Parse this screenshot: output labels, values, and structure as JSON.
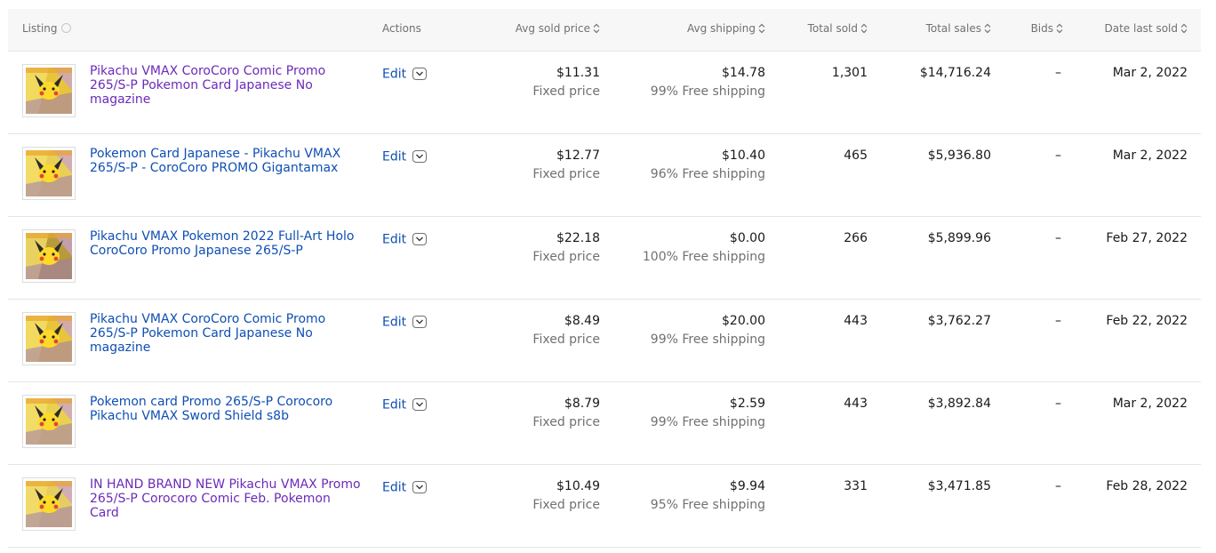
{
  "columns": {
    "listing": "Listing",
    "actions": "Actions",
    "avg_sold_price": "Avg sold price",
    "avg_shipping": "Avg shipping",
    "total_sold": "Total sold",
    "total_sales": "Total sales",
    "bids": "Bids",
    "date_last_sold": "Date last sold"
  },
  "icons": {
    "sort": "sort-icon",
    "info": "info-icon",
    "dropdown": "chevron-down-icon"
  },
  "colors": {
    "visited_link": "#6b2bb8",
    "link": "#0f4fb3",
    "muted": "#707070"
  },
  "rows": [
    {
      "title": "Pikachu VMAX CoroCoro Comic Promo 265/S-P Pokemon Card Japanese No magazine",
      "visited": true,
      "edit": "Edit",
      "price": "$11.31",
      "price_format": "Fixed price",
      "shipping": "$14.78",
      "free_shipping": "99% Free shipping",
      "total_sold": "1,301",
      "total_sales": "$14,716.24",
      "bids": "–",
      "date_last_sold": "Mar 2, 2022"
    },
    {
      "title": "Pokemon Card Japanese - Pikachu VMAX 265/S-P - CoroCoro PROMO Gigantamax",
      "visited": false,
      "edit": "Edit",
      "price": "$12.77",
      "price_format": "Fixed price",
      "shipping": "$10.40",
      "free_shipping": "96% Free shipping",
      "total_sold": "465",
      "total_sales": "$5,936.80",
      "bids": "–",
      "date_last_sold": "Mar 2, 2022"
    },
    {
      "title": "Pikachu VMAX Pokemon 2022 Full-Art Holo CoroCoro Promo Japanese 265/S-P",
      "visited": false,
      "edit": "Edit",
      "price": "$22.18",
      "price_format": "Fixed price",
      "shipping": "$0.00",
      "free_shipping": "100% Free shipping",
      "total_sold": "266",
      "total_sales": "$5,899.96",
      "bids": "–",
      "date_last_sold": "Feb 27, 2022"
    },
    {
      "title": "Pikachu VMAX CoroCoro Comic Promo 265/S-P Pokemon Card Japanese No magazine",
      "visited": false,
      "edit": "Edit",
      "price": "$8.49",
      "price_format": "Fixed price",
      "shipping": "$20.00",
      "free_shipping": "99% Free shipping",
      "total_sold": "443",
      "total_sales": "$3,762.27",
      "bids": "–",
      "date_last_sold": "Feb 22, 2022"
    },
    {
      "title": "Pokemon card Promo 265/S-P Corocoro Pikachu VMAX Sword Shield s8b",
      "visited": false,
      "edit": "Edit",
      "price": "$8.79",
      "price_format": "Fixed price",
      "shipping": "$2.59",
      "free_shipping": "99% Free shipping",
      "total_sold": "443",
      "total_sales": "$3,892.84",
      "bids": "–",
      "date_last_sold": "Mar 2, 2022"
    },
    {
      "title": "IN HAND BRAND NEW Pikachu VMAX Promo 265/S-P Corocoro Comic Feb. Pokemon Card",
      "visited": true,
      "edit": "Edit",
      "price": "$10.49",
      "price_format": "Fixed price",
      "shipping": "$9.94",
      "free_shipping": "95% Free shipping",
      "total_sold": "331",
      "total_sales": "$3,471.85",
      "bids": "–",
      "date_last_sold": "Feb 28, 2022"
    }
  ]
}
